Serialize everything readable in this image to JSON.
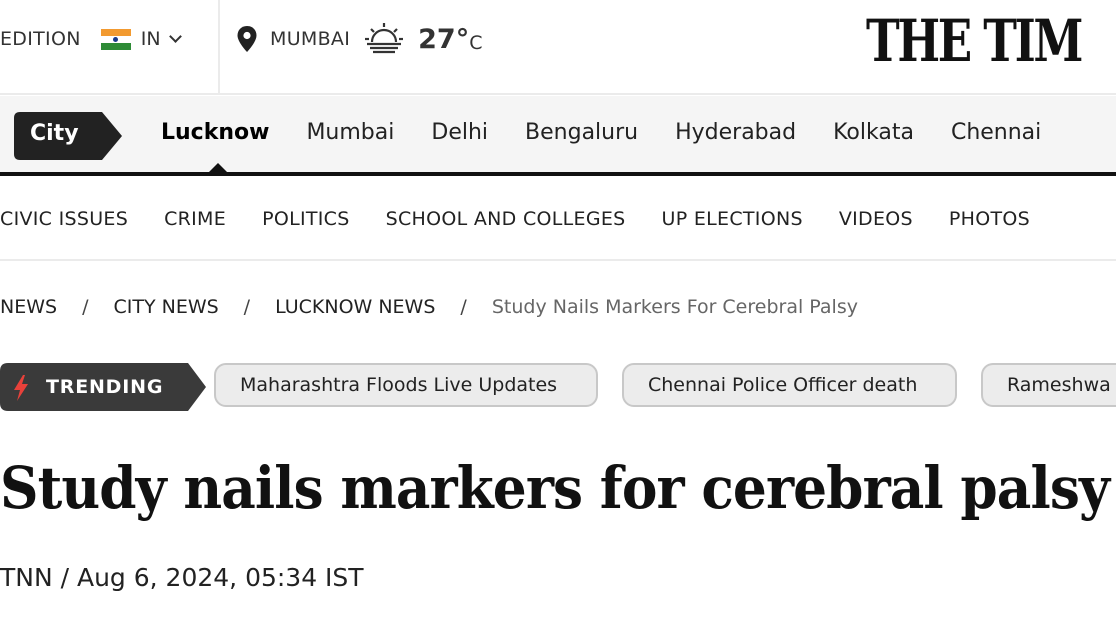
{
  "header": {
    "edition_label": "EDITION",
    "edition_value": "IN",
    "city": "MUMBAI",
    "temperature": "27°",
    "temperature_unit": "C",
    "logo_text": "THE TIM",
    "icons": [
      "india-flag-icon",
      "chevron-down-icon",
      "location-pin-icon",
      "sunrise-icon"
    ]
  },
  "city_nav": {
    "tag": "City",
    "items": [
      {
        "label": "Lucknow",
        "active": true
      },
      {
        "label": "Mumbai"
      },
      {
        "label": "Delhi"
      },
      {
        "label": "Bengaluru"
      },
      {
        "label": "Hyderabad"
      },
      {
        "label": "Kolkata"
      },
      {
        "label": "Chennai"
      }
    ]
  },
  "section_nav": {
    "items": [
      "CIVIC ISSUES",
      "CRIME",
      "POLITICS",
      "SCHOOL AND COLLEGES",
      "UP ELECTIONS",
      "VIDEOS",
      "PHOTOS"
    ]
  },
  "breadcrumb": {
    "items": [
      "NEWS",
      "CITY NEWS",
      "LUCKNOW NEWS"
    ],
    "separator": "/",
    "current": "Study Nails Markers For Cerebral Palsy"
  },
  "trending": {
    "label": "TRENDING",
    "icon": "lightning-bolt-icon",
    "pills": [
      "Maharashtra Floods Live Updates",
      "Chennai Police Officer death",
      "Rameshwa"
    ]
  },
  "article": {
    "headline": "Study nails markers for cerebral palsy",
    "byline": "TNN / Aug 6, 2024, 05:34 IST"
  },
  "colors": {
    "dark": "#222222",
    "trending_bg": "#3a3a3a",
    "bolt": "#e8413a",
    "flag_saffron": "#f29a30",
    "flag_green": "#2e8b36"
  }
}
